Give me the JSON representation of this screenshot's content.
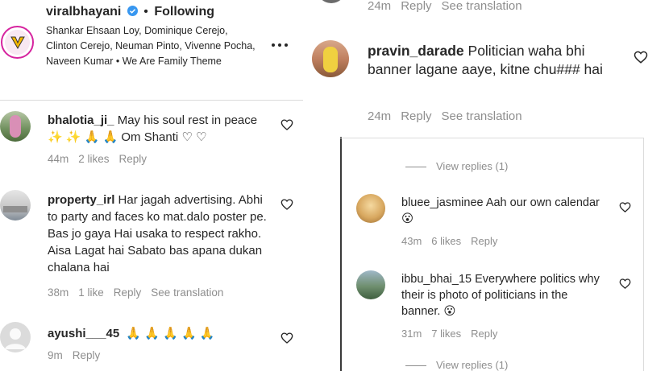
{
  "header": {
    "username": "viralbhayani",
    "following_label": "Following",
    "audio_credit": "Shankar Ehsaan Loy, Dominique Cerejo, Clinton Cerejo, Neuman Pinto, Vivenne Pocha, Naveen Kumar • We Are Family Theme",
    "more_icon": "more-icon",
    "verified_color": "#3897f0"
  },
  "left_comments": [
    {
      "username": "bhalotia_ji_",
      "text": "May his soul rest in peace ✨ ✨ 🙏 🙏 Om Shanti ♡ ♡",
      "time": "44m",
      "likes": "2 likes",
      "reply": "Reply"
    },
    {
      "username": "property_irl",
      "text": "Har jagah advertising. Abhi to party and faces ko mat.dalo poster pe. Bas jo gaya Hai usaka to respect rakho. Aisa Lagat hai Sabato bas apana dukan chalana hai",
      "time": "38m",
      "likes": "1 like",
      "reply": "Reply",
      "translate": "See translation"
    },
    {
      "username": "ayushi___45",
      "text": "🙏 🙏 🙏 🙏 🙏",
      "time": "9m",
      "reply": "Reply"
    }
  ],
  "right_top": {
    "prev_meta": {
      "time": "24m",
      "reply": "Reply",
      "translate": "See translation"
    },
    "comment": {
      "username": "pravin_darade",
      "text": "Politician waha bhi banner lagane aaye, kitne chu### hai",
      "time": "24m",
      "reply": "Reply",
      "translate": "See translation"
    }
  },
  "right_bottom": {
    "view_replies_top": "View replies (1)",
    "comments": [
      {
        "username": "bluee_jasminee",
        "text": "Aah our own calendar 😮",
        "time": "43m",
        "likes": "6 likes",
        "reply": "Reply"
      },
      {
        "username": "ibbu_bhai_15",
        "text": "Everywhere politics why their is photo of politicians in the banner. 😮",
        "time": "31m",
        "likes": "7 likes",
        "reply": "Reply"
      }
    ],
    "view_replies_bottom": "View replies (1)"
  },
  "colors": {
    "accent": "#3897f0",
    "meta": "#8e8e8e",
    "text": "#262626",
    "divider": "#dbdbdb"
  }
}
